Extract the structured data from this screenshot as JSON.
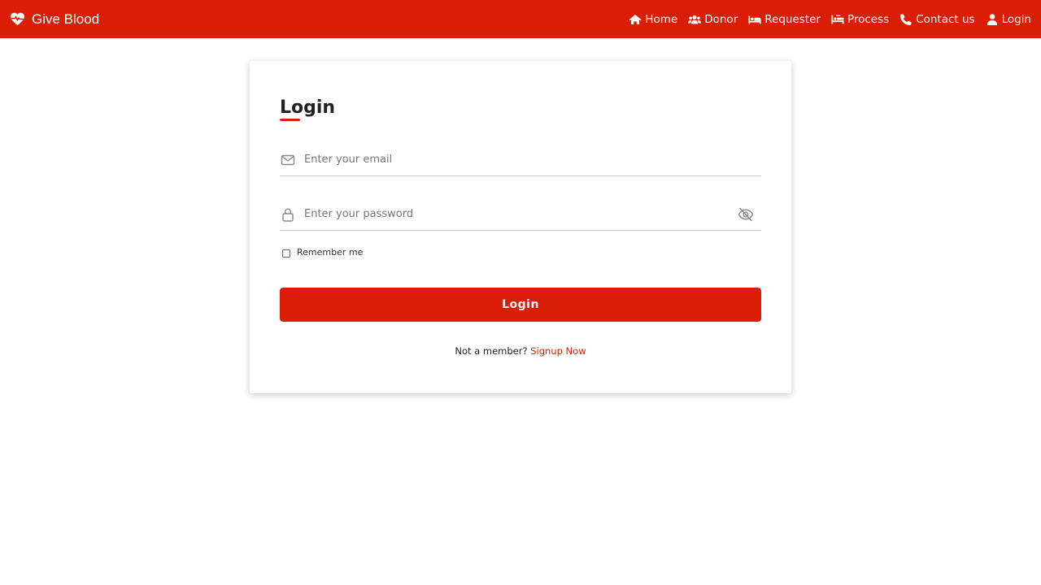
{
  "navbar": {
    "brand": "Give Blood",
    "brand_icon": "heart-pulse-icon",
    "items": [
      {
        "label": "Home",
        "icon": "home-icon"
      },
      {
        "label": "Donor",
        "icon": "users-icon"
      },
      {
        "label": "Requester",
        "icon": "bed-icon"
      },
      {
        "label": "Process",
        "icon": "procedures-icon"
      },
      {
        "label": "Contact us",
        "icon": "phone-icon"
      },
      {
        "label": "Login",
        "icon": "user-icon"
      }
    ]
  },
  "form": {
    "title": "Login",
    "email_placeholder": "Enter your email",
    "password_placeholder": "Enter your password",
    "remember_label": "Remember me",
    "submit_label": "Login",
    "signup_prompt": "Not a member?",
    "signup_link": "Signup Now"
  },
  "colors": {
    "brand": "#d91e05",
    "background": "#ffffff"
  }
}
